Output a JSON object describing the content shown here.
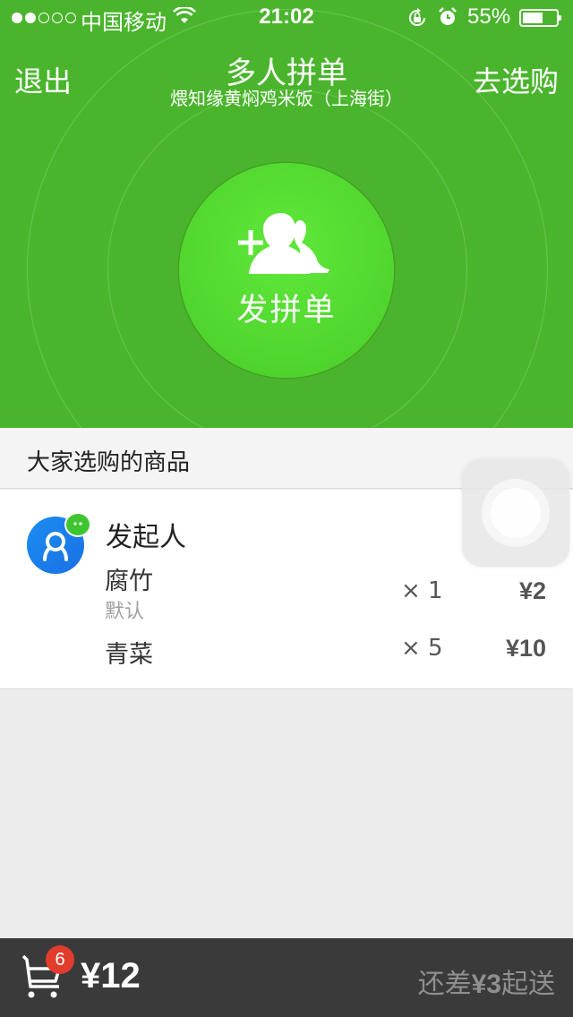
{
  "status_bar": {
    "carrier": "中国移动",
    "time": "21:02",
    "battery_percent": "55%",
    "battery_level": 0.55
  },
  "nav": {
    "back_label": "退出",
    "title": "多人拼单",
    "subtitle": "煨知缘黄焖鸡米饭（上海街）",
    "action_label": "去选购"
  },
  "hero": {
    "button_label": "发拼单",
    "icon": "add-group-icon"
  },
  "section": {
    "title": "大家选购的商品"
  },
  "order": {
    "initiator": "发起人",
    "items": [
      {
        "name": "腐竹",
        "spec": "默认",
        "qty": "× 1",
        "price": "¥2"
      },
      {
        "name": "青菜",
        "spec": "",
        "qty": "× 5",
        "price": "¥10"
      }
    ]
  },
  "footer": {
    "cart_count": "6",
    "total": "¥12",
    "shortfall_prefix": "还差",
    "shortfall_amount": "¥3",
    "shortfall_suffix": "起送"
  },
  "colors": {
    "brand_green": "#4ab52c",
    "button_green": "#54d82f",
    "footer_bg": "#3a3a3a",
    "badge_red": "#e23c2c"
  }
}
